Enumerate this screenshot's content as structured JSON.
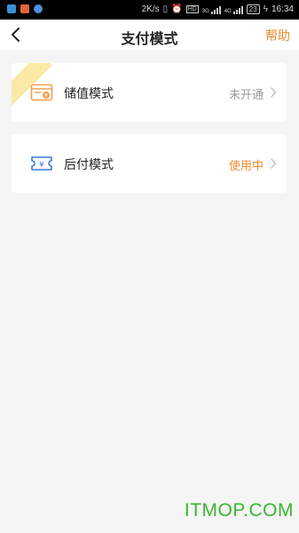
{
  "status_bar": {
    "net_speed": "2K/s",
    "battery": "23",
    "time": "16:34",
    "hd_label": "HD",
    "sig1_label": "3G",
    "sig2_label": "4G"
  },
  "header": {
    "title": "支付模式",
    "help_label": "帮助"
  },
  "modes": [
    {
      "label": "储值模式",
      "status": "未开通",
      "icon": "wallet-icon",
      "status_color": "#999999"
    },
    {
      "label": "后付模式",
      "status": "使用中",
      "icon": "ticket-yen-icon",
      "status_color": "#f08a2b"
    }
  ],
  "watermark": "ITMOP.COM",
  "colors": {
    "accent": "#f08a2b",
    "icon_orange": "#f5a04a",
    "icon_blue": "#3a7fd6",
    "ribbon": "#fbe9a6"
  }
}
